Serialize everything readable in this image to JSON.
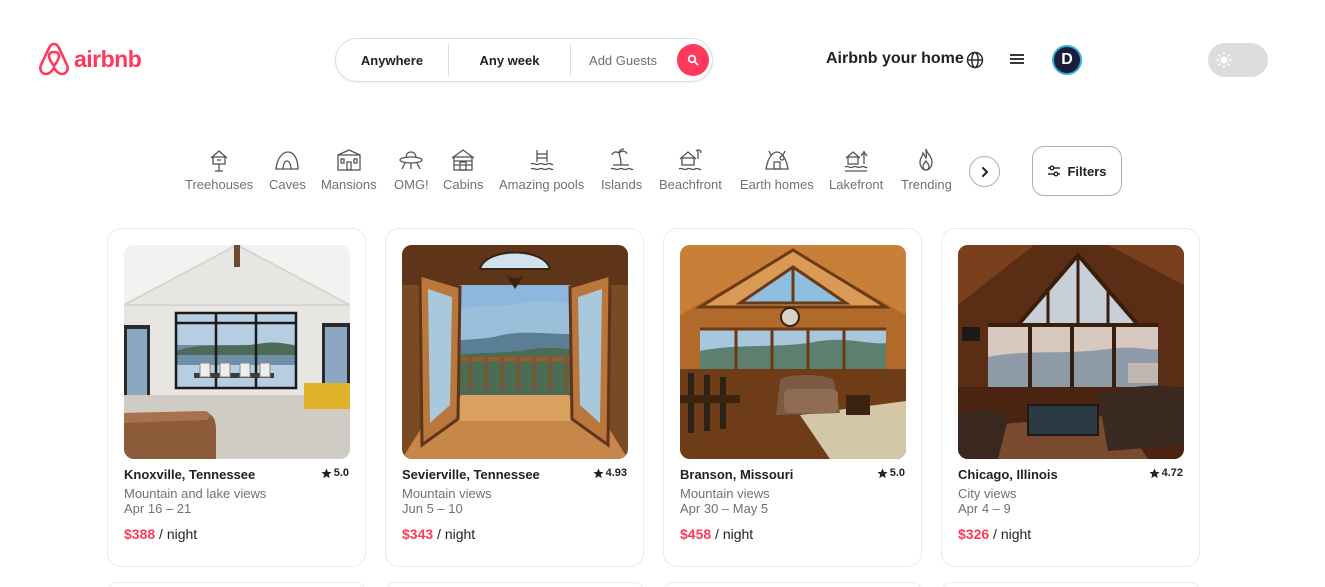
{
  "colors": {
    "brand": "#ff385c"
  },
  "header": {
    "logo_text": "airbnb",
    "host_link": "Airbnb your home",
    "avatar_initial": "D"
  },
  "search": {
    "anywhere": "Anywhere",
    "any_week": "Any week",
    "guests_placeholder": "Add Guests"
  },
  "categories": [
    {
      "label": "Treehouses",
      "icon": "treehouse-icon"
    },
    {
      "label": "Caves",
      "icon": "cave-icon"
    },
    {
      "label": "Mansions",
      "icon": "mansion-icon"
    },
    {
      "label": "OMG!",
      "icon": "ufo-icon"
    },
    {
      "label": "Cabins",
      "icon": "cabin-icon"
    },
    {
      "label": "Amazing pools",
      "icon": "pool-icon"
    },
    {
      "label": "Islands",
      "icon": "island-icon"
    },
    {
      "label": "Beachfront",
      "icon": "beachfront-icon"
    },
    {
      "label": "Earth homes",
      "icon": "earth-home-icon"
    },
    {
      "label": "Lakefront",
      "icon": "lakefront-icon"
    },
    {
      "label": "Trending",
      "icon": "fire-icon"
    }
  ],
  "filters_label": "Filters",
  "listings": [
    {
      "location": "Knoxville, Tennessee",
      "rating": "5.0",
      "description": "Mountain and lake views",
      "dates": "Apr 16 – 21",
      "price": "$388",
      "price_unit": " / night"
    },
    {
      "location": "Sevierville, Tennessee",
      "rating": "4.93",
      "description": "Mountain views",
      "dates": "Jun 5 – 10",
      "price": "$343",
      "price_unit": " / night"
    },
    {
      "location": "Branson, Missouri",
      "rating": "5.0",
      "description": "Mountain views",
      "dates": "Apr 30 – May 5",
      "price": "$458",
      "price_unit": " / night"
    },
    {
      "location": "Chicago, Illinois",
      "rating": "4.72",
      "description": "City views",
      "dates": "Apr 4 – 9",
      "price": "$326",
      "price_unit": " / night"
    }
  ]
}
